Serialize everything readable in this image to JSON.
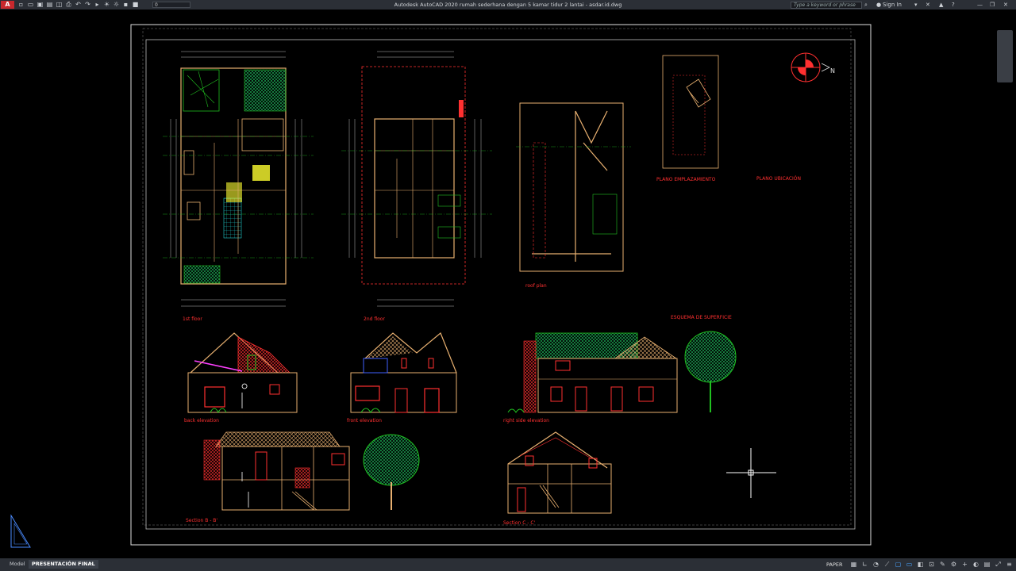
{
  "app": {
    "logo": "A",
    "title": "Autodesk AutoCAD 2020   rumah sederhana dengan 5 kamar tidur 2 lantai - asdar.id.dwg"
  },
  "toolbar": {
    "layer_value": "0"
  },
  "search": {
    "placeholder": "Type a keyword or phrase"
  },
  "account": {
    "sign_in": "Sign In"
  },
  "drawing": {
    "labels": {
      "first_floor": "1st floor",
      "second_floor": "2nd floor",
      "roof_plan": "roof plan",
      "plano_emplazamiento": "PLANO EMPLAZAMIENTO",
      "plano_ubicacion": "PLANO UBICACIÓN",
      "esquema": "ESQUEMA DE SUPERFICIE",
      "back_elevation": "back elevation",
      "front_elevation": "front elevation",
      "right_side_elevation": "right side elevation",
      "section_b": "Section B - B'",
      "section_c": "Section C - C'",
      "north": "N"
    }
  },
  "status": {
    "tabs": [
      "Model",
      "PRESENTACIÓN FINAL"
    ],
    "add_tab": "+",
    "paper": "PAPER"
  },
  "colors": {
    "red": "#ff2020",
    "yellow": "#ffff30",
    "green": "#20d020",
    "cyan": "#20d0d0",
    "magenta": "#ff40ff",
    "white": "#ffffff",
    "tan": "#e8b070"
  }
}
